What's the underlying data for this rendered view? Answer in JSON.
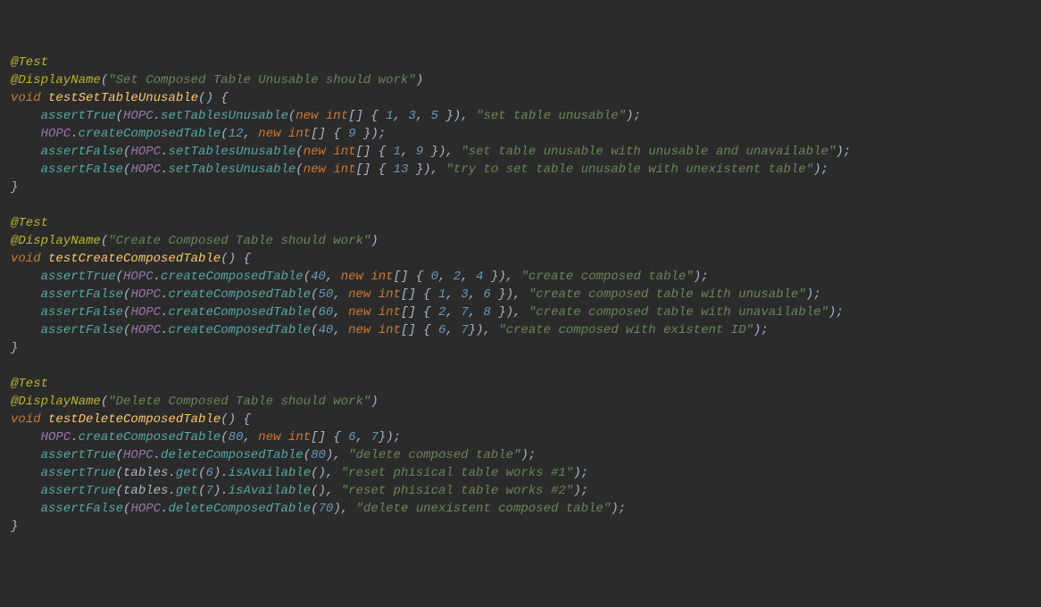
{
  "tests": [
    {
      "annotation": "@Test",
      "displayNameAnn": "@DisplayName",
      "displayName": "\"Set Composed Table Unusable should work\"",
      "voidKw": "void",
      "methodName": "testSetTableUnusable",
      "lines": [
        {
          "indent": "    ",
          "call": "assertTrue",
          "open": "(",
          "obj": "HOPC",
          "dot": ".",
          "m": "setTablesUnusable",
          "args_open": "(",
          "new": "new",
          "space": " ",
          "type": "int",
          "brackets": "[] { ",
          "nums": [
            "1",
            "3",
            "5"
          ],
          "close_arr": " }",
          "close_call": ")",
          "comma": ", ",
          "msg": "\"set table unusable\"",
          "end": ");"
        },
        {
          "indent": "    ",
          "obj": "HOPC",
          "dot": ".",
          "m": "createComposedTable",
          "args_open": "(",
          "first": "12",
          "comma1": ", ",
          "new": "new",
          "space": " ",
          "type": "int",
          "brackets": "[] { ",
          "nums": [
            "9"
          ],
          "close_arr": " }",
          "end": ");"
        },
        {
          "indent": "    ",
          "call": "assertFalse",
          "open": "(",
          "obj": "HOPC",
          "dot": ".",
          "m": "setTablesUnusable",
          "args_open": "(",
          "new": "new",
          "space": " ",
          "type": "int",
          "brackets": "[] { ",
          "nums": [
            "1",
            "9"
          ],
          "close_arr": " }",
          "close_call": ")",
          "comma": ", ",
          "msg": "\"set table unusable with unusable and unavailable\"",
          "end": ");"
        },
        {
          "indent": "    ",
          "call": "assertFalse",
          "open": "(",
          "obj": "HOPC",
          "dot": ".",
          "m": "setTablesUnusable",
          "args_open": "(",
          "new": "new",
          "space": " ",
          "type": "int",
          "brackets": "[] { ",
          "nums": [
            "13"
          ],
          "close_arr": " }",
          "close_call": ")",
          "comma": ", ",
          "msg": "\"try to set table unusable with unexistent table\"",
          "end": ");"
        }
      ]
    },
    {
      "annotation": "@Test",
      "displayNameAnn": "@DisplayName",
      "displayName": "\"Create Composed Table should work\"",
      "voidKw": "void",
      "methodName": "testCreateComposedTable",
      "lines": [
        {
          "indent": "    ",
          "call": "assertTrue",
          "open": "(",
          "obj": "HOPC",
          "dot": ".",
          "m": "createComposedTable",
          "args_open": "(",
          "first": "40",
          "comma1": ", ",
          "new": "new",
          "space": " ",
          "type": "int",
          "brackets": "[] { ",
          "nums": [
            "0",
            "2",
            "4"
          ],
          "close_arr": " }",
          "close_call": ")",
          "comma": ", ",
          "msg": "\"create composed table\"",
          "end": ");"
        },
        {
          "indent": "    ",
          "call": "assertFalse",
          "open": "(",
          "obj": "HOPC",
          "dot": ".",
          "m": "createComposedTable",
          "args_open": "(",
          "first": "50",
          "comma1": ", ",
          "new": "new",
          "space": " ",
          "type": "int",
          "brackets": "[] { ",
          "nums": [
            "1",
            "3",
            "6"
          ],
          "close_arr": " }",
          "close_call": ")",
          "comma": ", ",
          "msg": "\"create composed table with unusable\"",
          "end": ");"
        },
        {
          "indent": "    ",
          "call": "assertFalse",
          "open": "(",
          "obj": "HOPC",
          "dot": ".",
          "m": "createComposedTable",
          "args_open": "(",
          "first": "60",
          "comma1": ", ",
          "new": "new",
          "space": " ",
          "type": "int",
          "brackets": "[] { ",
          "nums": [
            "2",
            "7",
            "8"
          ],
          "close_arr": " }",
          "close_call": ")",
          "comma": ", ",
          "msg": "\"create composed table with unavailable\"",
          "end": ");"
        },
        {
          "indent": "    ",
          "call": "assertFalse",
          "open": "(",
          "obj": "HOPC",
          "dot": ".",
          "m": "createComposedTable",
          "args_open": "(",
          "first": "40",
          "comma1": ", ",
          "new": "new",
          "space": " ",
          "type": "int",
          "brackets": "[] { ",
          "nums": [
            "6",
            "7"
          ],
          "close_arr": "}",
          "close_call": ")",
          "comma": ", ",
          "msg": "\"create composed with existent ID\"",
          "end": ");"
        }
      ]
    },
    {
      "annotation": "@Test",
      "displayNameAnn": "@DisplayName",
      "displayName": "\"Delete Composed Table should work\"",
      "voidKw": "void",
      "methodName": "testDeleteComposedTable",
      "lines": [
        {
          "indent": "    ",
          "obj": "HOPC",
          "dot": ".",
          "m": "createComposedTable",
          "args_open": "(",
          "first": "80",
          "comma1": ", ",
          "new": "new",
          "space": " ",
          "type": "int",
          "brackets": "[] { ",
          "nums": [
            "6",
            "7"
          ],
          "close_arr": "}",
          "end": ");"
        },
        {
          "indent": "    ",
          "call": "assertTrue",
          "open": "(",
          "obj": "HOPC",
          "dot": ".",
          "m": "deleteComposedTable",
          "args_open": "(",
          "first": "80",
          "close_call": ")",
          "comma": ", ",
          "msg": "\"delete composed table\"",
          "end": ");"
        },
        {
          "indent": "    ",
          "call": "assertTrue",
          "open": "(",
          "obj2": "tables",
          "dot": ".",
          "m": "get",
          "args_open": "(",
          "first": "6",
          "close_call": ")",
          "dot2": ".",
          "m2": "isAvailable",
          "open2": "()",
          "comma": ", ",
          "msg": "\"reset phisical table works #1\"",
          "end": ");"
        },
        {
          "indent": "    ",
          "call": "assertTrue",
          "open": "(",
          "obj2": "tables",
          "dot": ".",
          "m": "get",
          "args_open": "(",
          "first": "7",
          "close_call": ")",
          "dot2": ".",
          "m2": "isAvailable",
          "open2": "()",
          "comma": ", ",
          "msg": "\"reset phisical table works #2\"",
          "end": ");"
        },
        {
          "indent": "    ",
          "call": "assertFalse",
          "open": "(",
          "obj": "HOPC",
          "dot": ".",
          "m": "deleteComposedTable",
          "args_open": "(",
          "first": "70",
          "close_call": ")",
          "comma": ", ",
          "msg": "\"delete unexistent composed table\"",
          "end": ");"
        }
      ]
    }
  ],
  "openBrace": "() {",
  "closeBrace": "}"
}
